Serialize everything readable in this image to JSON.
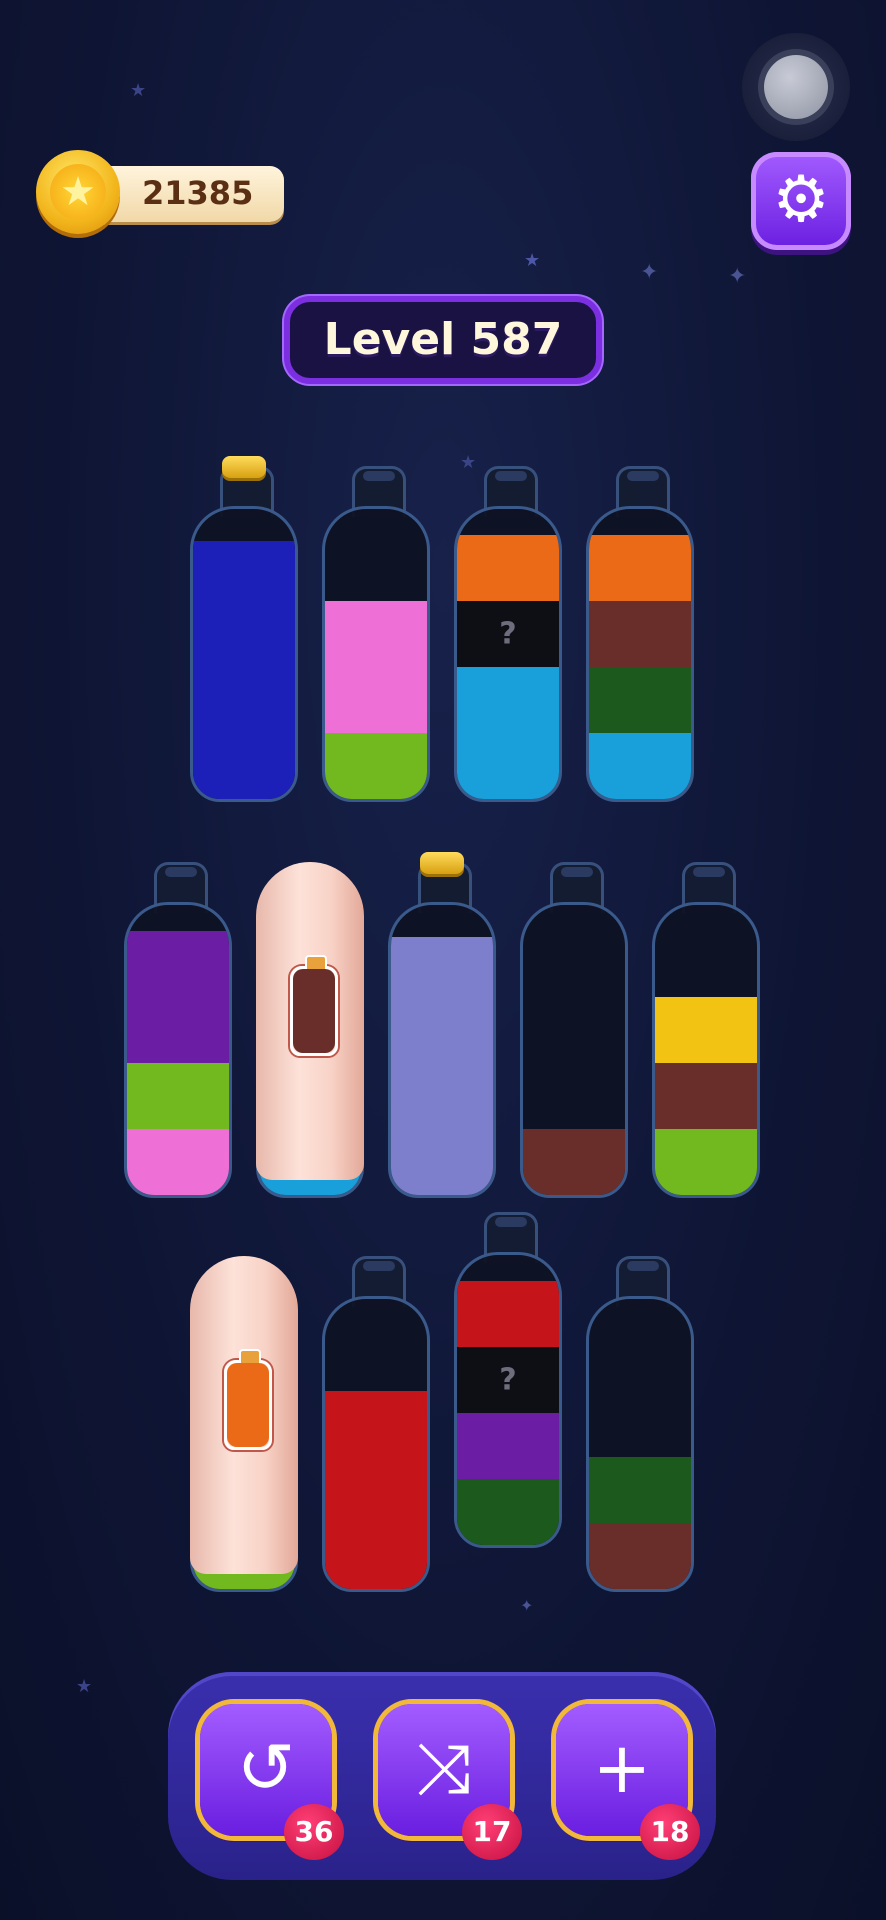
{
  "coins": {
    "value": "21385",
    "icon": "star-coin-icon"
  },
  "level": {
    "label": "Level 587"
  },
  "settings": {
    "icon": "gear-icon"
  },
  "colors": {
    "blue": "#1c1fb8",
    "pink": "#ee6fd6",
    "lime": "#72b91f",
    "orange": "#ea6a17",
    "cyan": "#199fd9",
    "brown": "#6a2e2a",
    "darkgreen": "#1b5a1c",
    "purple": "#6b1ea4",
    "lavender": "#7d7fcc",
    "yellow": "#f2c313",
    "red": "#c5151a",
    "mystery": "#0e0f14"
  },
  "rows": [
    [
      {
        "cork": true,
        "layers": [
          {
            "color": "blue",
            "size": 4
          }
        ]
      },
      {
        "layers": [
          {
            "color": "lime",
            "size": 1
          },
          {
            "color": "pink",
            "size": 2
          }
        ]
      },
      {
        "layers": [
          {
            "color": "cyan",
            "size": 2
          },
          {
            "color": "mystery",
            "size": 1,
            "text": "?"
          },
          {
            "color": "orange",
            "size": 1
          }
        ]
      },
      {
        "layers": [
          {
            "color": "cyan",
            "size": 1
          },
          {
            "color": "darkgreen",
            "size": 1
          },
          {
            "color": "brown",
            "size": 1
          },
          {
            "color": "orange",
            "size": 1
          }
        ]
      }
    ],
    [
      {
        "layers": [
          {
            "color": "pink",
            "size": 1
          },
          {
            "color": "lime",
            "size": 1
          },
          {
            "color": "purple",
            "size": 2
          }
        ]
      },
      {
        "covered": true,
        "hint_color": "brown",
        "base_color": "cyan"
      },
      {
        "cork": true,
        "layers": [
          {
            "color": "lavender",
            "size": 4
          }
        ]
      },
      {
        "layers": [
          {
            "color": "brown",
            "size": 1
          }
        ]
      },
      {
        "layers": [
          {
            "color": "lime",
            "size": 1
          },
          {
            "color": "brown",
            "size": 1
          },
          {
            "color": "yellow",
            "size": 1
          }
        ]
      }
    ],
    [
      {
        "covered": true,
        "hint_color": "orange",
        "base_color": "lime"
      },
      {
        "layers": [
          {
            "color": "red",
            "size": 3
          }
        ]
      },
      {
        "layers": [
          {
            "color": "darkgreen",
            "size": 1
          },
          {
            "color": "purple",
            "size": 1
          },
          {
            "color": "mystery",
            "size": 1,
            "text": "?"
          },
          {
            "color": "red",
            "size": 1
          }
        ]
      },
      {
        "layers": [
          {
            "color": "brown",
            "size": 1
          },
          {
            "color": "darkgreen",
            "size": 1
          }
        ]
      }
    ]
  ],
  "tools": [
    {
      "name": "undo",
      "icon": "undo-icon",
      "glyph": "↺",
      "count": "36"
    },
    {
      "name": "shuffle",
      "icon": "shuffle-icon",
      "glyph": "⤨",
      "count": "17"
    },
    {
      "name": "add-bottle",
      "icon": "add-bottle-icon",
      "glyph": "+",
      "count": "18"
    }
  ]
}
